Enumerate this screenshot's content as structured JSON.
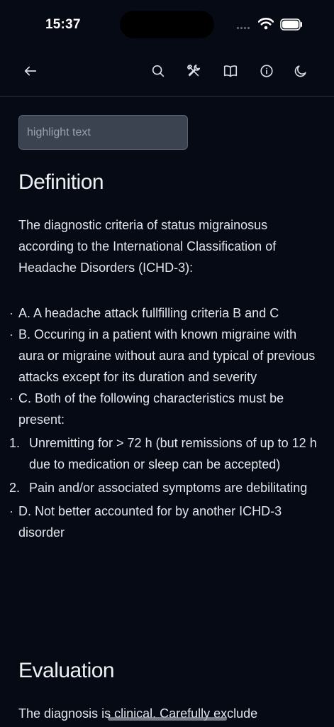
{
  "status": {
    "time": "15:37"
  },
  "search": {
    "placeholder": "highlight text"
  },
  "definition": {
    "heading": "Definition",
    "intro": "The diagnostic criteria of status migrainosus according to the International Classification of Headache Disorders (ICHD-3):",
    "bullet_glyph": "·",
    "items": [
      "A. A headache attack fullfilling criteria B and C",
      "B. Occuring in a patient with known migraine with aura or migraine without aura and typical of previous attacks except for its duration and severity",
      "C. Both of the following characteristics must be present:"
    ],
    "numbered": [
      {
        "n": "1.",
        "text": "Unremitting for > 72 h (but remissions of up to 12 h due to medication or sleep can be accepted)"
      },
      {
        "n": "2.",
        "text": "Pain and/or associated symptoms are debilitating"
      }
    ],
    "last": "D. Not better accounted for by another ICHD-3 disorder"
  },
  "evaluation": {
    "heading": "Evaluation",
    "intro": "The diagnosis is clinical. Carefully exclude"
  },
  "icons": {
    "back": "arrow-left-icon",
    "search": "search-icon",
    "tools": "tools-icon",
    "book": "book-open-icon",
    "info": "info-icon",
    "theme": "moon-icon"
  },
  "colors": {
    "background": "#060a14",
    "input": "#3b4250",
    "text": "#e3e5ea"
  }
}
